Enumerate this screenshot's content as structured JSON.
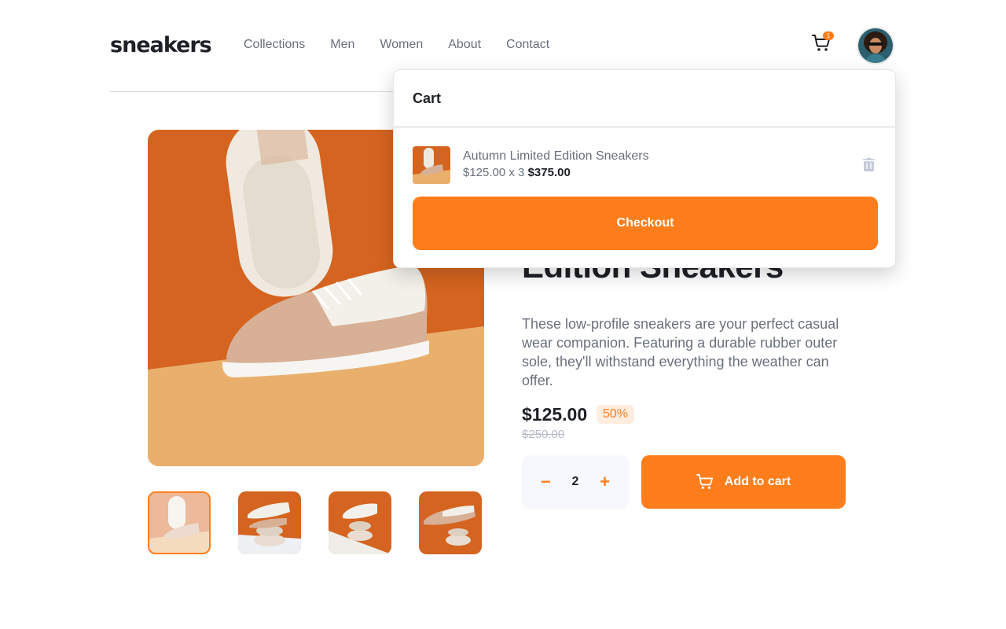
{
  "brand": {
    "logo": "sneakers"
  },
  "nav": {
    "items": [
      "Collections",
      "Men",
      "Women",
      "About",
      "Contact"
    ]
  },
  "header": {
    "cart_count": "1",
    "cart_icon": "cart-icon",
    "avatar": "user-avatar"
  },
  "product": {
    "title": "Edition Sneakers",
    "description": "These low-profile sneakers are your perfect casual wear companion. Featuring a durable rubber outer sole, they'll withstand everything the weather can offer.",
    "price": "$125.00",
    "discount": "50%",
    "old_price": "$250.00",
    "quantity": "2",
    "minus": "−",
    "plus": "+",
    "add_to_cart": "Add to cart"
  },
  "cart": {
    "title": "Cart",
    "item": {
      "name": "Autumn Limited Edition Sneakers",
      "unit_price": "$125.00 x 3",
      "total": "$375.00"
    },
    "checkout": "Checkout"
  },
  "colors": {
    "accent": "#ff7e1b",
    "accent_pale": "#ffede0",
    "dark_text": "#1d2026",
    "gray_text": "#69707d",
    "light_bg": "#f6f8fd"
  }
}
